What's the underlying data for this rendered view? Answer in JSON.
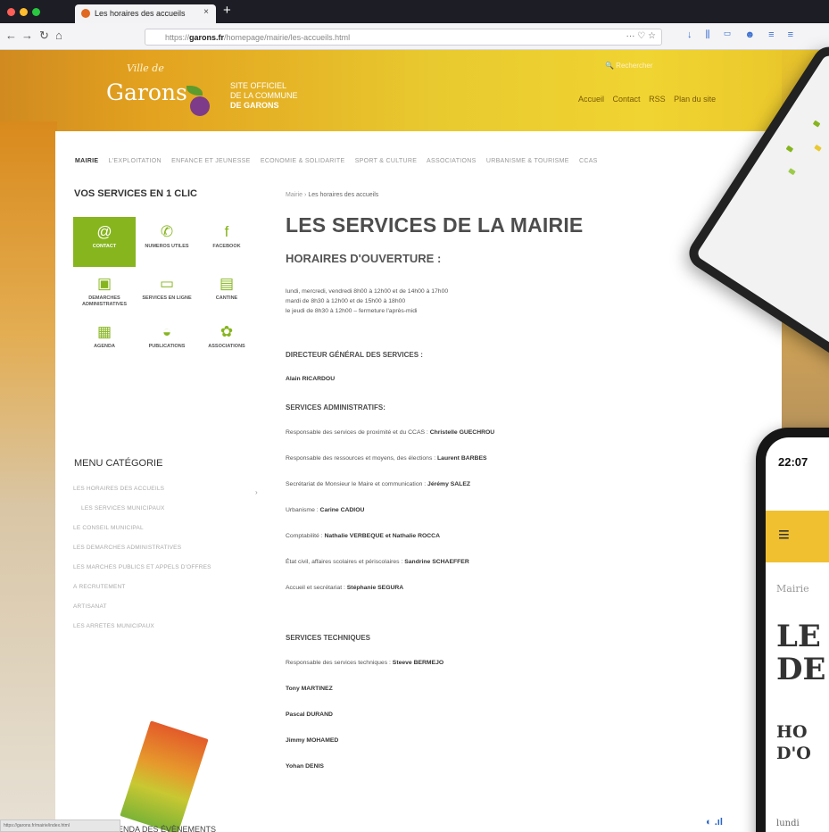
{
  "browser": {
    "tab_title": "Les horaires des accueils",
    "tab_close": "×",
    "new_tab": "+",
    "nav": {
      "back": "←",
      "forward": "→",
      "reload": "↻",
      "home": "⌂"
    },
    "url_prefix": "https://",
    "url_domain": "garons.fr",
    "url_path": "/homepage/mairie/les-accueils.html",
    "url_icons": "··· ♡ ☆",
    "toolbar_icons": "↓ ⫼ ▭ ☻ ≡ ≡",
    "status_url": "https://garons.fr/mairie/index.html"
  },
  "site": {
    "logo_small": "Ville de",
    "logo_name": "Garons",
    "tagline": [
      "SITE OFFICIEL",
      "DE LA COMMUNE",
      "DE GARONS"
    ],
    "search_label": "🔍 Rechercher",
    "topnav": [
      "Accueil",
      "Contact",
      "RSS",
      "Plan du site"
    ],
    "mainnav": [
      "MAIRIE",
      "L'EXPLOITATION",
      "ENFANCE ET JEUNESSE",
      "ÉCONOMIE & SOLIDARITÉ",
      "SPORT & CULTURE",
      "ASSOCIATIONS",
      "URBANISME & TOURISME",
      "CCAS"
    ]
  },
  "sidebar": {
    "services_title": "VOS SERVICES EN 1 CLIC",
    "services": [
      {
        "label": "CONTACT",
        "icon": "@",
        "icon_name": "at-icon"
      },
      {
        "label": "NUMEROS UTILES",
        "icon": "✆",
        "icon_name": "phone-icon"
      },
      {
        "label": "FACEBOOK",
        "icon": "f",
        "icon_name": "facebook-icon"
      },
      {
        "label": "DEMARCHES ADMINISTRATIVES",
        "icon": "▣",
        "icon_name": "document-icon"
      },
      {
        "label": "SERVICES EN LIGNE",
        "icon": "▭",
        "icon_name": "laptop-icon"
      },
      {
        "label": "CANTINE",
        "icon": "▤",
        "icon_name": "cantine-icon"
      },
      {
        "label": "AGENDA",
        "icon": "▦",
        "icon_name": "calendar-icon"
      },
      {
        "label": "PUBLICATIONS",
        "icon": "◒",
        "icon_name": "publications-icon"
      },
      {
        "label": "ASSOCIATIONS",
        "icon": "✿",
        "icon_name": "associations-icon"
      }
    ],
    "menu_title": "MENU CATÉGORIE",
    "menu_items": [
      "LES HORAIRES DES ACCUEILS",
      "LES SERVICES MUNICIPAUX",
      "LE CONSEIL MUNICIPAL",
      "LES DEMARCHES ADMINISTRATIVES",
      "LES MARCHÉS PUBLICS ET APPELS D'OFFRES",
      "À RECRUTEMENT",
      "ARTISANAT",
      "LES ARRÊTÉS MUNICIPAUX"
    ],
    "menu_chevron": "›",
    "agenda_label": "AGENDA DES ÉVÈNEMENTS"
  },
  "content": {
    "breadcrumb": [
      "Mairie",
      "Les horaires des accueils"
    ],
    "breadcrumb_sep": "›",
    "title": "LES SERVICES DE LA MAIRIE",
    "subtitle": "HORAIRES D'OUVERTURE :",
    "hours": [
      "lundi, mercredi, vendredi 8h00 à 12h00 et de 14h00 à 17h00",
      "mardi de 8h30 à 12h00 et de 15h00 à 18h00",
      "le jeudi de 8h30 à 12h00 – fermeture l'après-midi"
    ],
    "dgs_title": "DIRECTEUR GÉNÉRAL DES SERVICES :",
    "dgs_name": "Alain RICARDOU",
    "admin_title": "SERVICES ADMINISTRATIFS:",
    "admin": [
      {
        "role": "Responsable des services de proximité et du CCAS :",
        "name": "Christelle GUECHROU"
      },
      {
        "role": "Responsable des ressources et moyens, des élections :",
        "name": "Laurent BARBES"
      },
      {
        "role": "Secrétariat de Monsieur le Maire et communication :",
        "name": "Jérémy SALEZ"
      },
      {
        "role": "Urbanisme :",
        "name": "Carine CADIOU"
      },
      {
        "role": "Comptabilité :",
        "name": "Nathalie VERBEQUE et Nathalie ROCCA"
      },
      {
        "role": "État civil, affaires scolaires et périscolaires :",
        "name": "Sandrine SCHAEFFER"
      },
      {
        "role": "Accueil et secrétariat :",
        "name": "Stéphanie SEGURA"
      }
    ],
    "tech_title": "SERVICES TECHNIQUES",
    "tech_lead_role": "Responsable des services techniques :",
    "tech_lead_name": "Steeve BERMEJO",
    "tech_staff": [
      "Tony MARTINEZ",
      "Pascal DURAND",
      "Jimmy MOHAMED",
      "Yohan DENIS"
    ]
  },
  "phone": {
    "time": "22:07",
    "menu_icon": "≡",
    "crumb": "Mairie",
    "h1_lines": [
      "LE",
      "DE"
    ],
    "h2_lines": [
      "HO",
      "D'O"
    ],
    "body": "lundi"
  },
  "system": {
    "tray": "◐ .ıl"
  },
  "colors": {
    "accent_green": "#86b51e",
    "header_yellow": "#e8c92f"
  }
}
